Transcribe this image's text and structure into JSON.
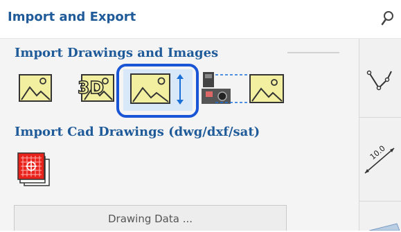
{
  "header": {
    "title": "Import and Export"
  },
  "section_drawings": {
    "title": "Import Drawings and Images"
  },
  "section_cad": {
    "title": "Import Cad Drawings (dwg/dxf/sat)"
  },
  "tool_3d": {
    "label": "3D"
  },
  "sidebar": {
    "dimension_label": "10.0"
  },
  "action_button": {
    "label": "Drawing Data ..."
  },
  "colors": {
    "accent": "#1f5a99",
    "selection": "#1a55d6",
    "image_fill": "#f2efa1"
  }
}
